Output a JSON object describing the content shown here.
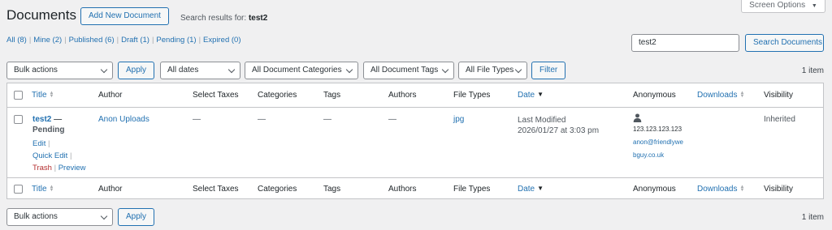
{
  "header": {
    "title": "Documents",
    "add_new_label": "Add New Document",
    "search_results_prefix": "Search results for:",
    "search_term": "test2",
    "screen_options_label": "Screen Options"
  },
  "views": [
    {
      "label": "All",
      "count": "(8)"
    },
    {
      "label": "Mine",
      "count": "(2)"
    },
    {
      "label": "Published",
      "count": "(6)"
    },
    {
      "label": "Draft",
      "count": "(1)"
    },
    {
      "label": "Pending",
      "count": "(1)"
    },
    {
      "label": "Expired",
      "count": "(0)"
    }
  ],
  "search": {
    "value": "test2",
    "button_label": "Search Documents"
  },
  "top_nav": {
    "bulk_actions": "Bulk actions",
    "apply_label": "Apply",
    "date_filter": "All dates",
    "category_filter": "All Document Categories",
    "tag_filter": "All Document Tags",
    "filetype_filter": "All File Types",
    "filter_label": "Filter",
    "item_count": "1 item"
  },
  "columns": {
    "title": "Title",
    "author": "Author",
    "select_taxes": "Select Taxes",
    "categories": "Categories",
    "tags": "Tags",
    "authors": "Authors",
    "file_types": "File Types",
    "date": "Date",
    "anonymous": "Anonymous",
    "downloads": "Downloads",
    "visibility": "Visibility"
  },
  "rows": [
    {
      "title": "test2",
      "title_sep": "—",
      "state": "Pending",
      "actions": {
        "edit": "Edit",
        "quick_edit": "Quick Edit",
        "trash": "Trash",
        "preview": "Preview"
      },
      "author": "Anon Uploads",
      "select_taxes": "—",
      "categories": "—",
      "tags": "—",
      "authors": "—",
      "file_types": "jpg",
      "date_label": "Last Modified",
      "date_value": "2026/01/27 at 3:03 pm",
      "anonymous_ip": "123.123.123.123",
      "anonymous_email_line1": "anon@friendlywe",
      "anonymous_email_line2": "bguy.co.uk",
      "downloads": "",
      "visibility": "Inherited"
    }
  ],
  "bottom_nav": {
    "bulk_actions": "Bulk actions",
    "apply_label": "Apply",
    "item_count": "1 item"
  },
  "colors": {
    "link": "#2271b1",
    "trash": "#b32d2e",
    "background": "#f0f0f1"
  }
}
